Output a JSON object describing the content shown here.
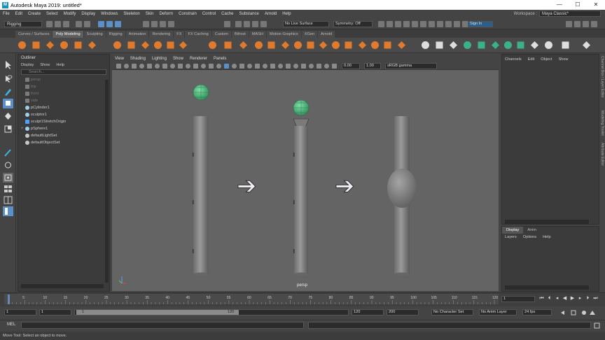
{
  "window": {
    "title": "Autodesk Maya 2019: untitled*",
    "app_icon": "maya-icon",
    "minimize": "—",
    "maximize": "☐",
    "close": "✕"
  },
  "menubar": [
    "File",
    "Edit",
    "Create",
    "Select",
    "Modify",
    "Display",
    "Windows",
    "Skeleton",
    "Skin",
    "Deform",
    "Constrain",
    "Control",
    "Cache",
    "Substance",
    "Arnold",
    "Help"
  ],
  "workspace": {
    "label": "Workspace :",
    "value": "Maya Classic*"
  },
  "statusline": {
    "mode": "Rigging",
    "live_surface": "No Live Surface",
    "symmetry": "Symmetry: Off",
    "sign_in": "Sign In"
  },
  "shelf_tabs": [
    "Curves / Surfaces",
    "Poly Modeling",
    "Sculpting",
    "Rigging",
    "Animation",
    "Rendering",
    "FX",
    "FX Caching",
    "Custom",
    "Bifrost",
    "MASH",
    "Motion Graphics",
    "XGen",
    "Arnold"
  ],
  "shelf_active": "Poly Modeling",
  "outliner": {
    "title": "Outliner",
    "menus": [
      "Display",
      "Show",
      "Help"
    ],
    "search_placeholder": "Search...",
    "items": [
      {
        "label": "persp",
        "dim": true,
        "icon": "camera-icon"
      },
      {
        "label": "top",
        "dim": true,
        "icon": "camera-icon"
      },
      {
        "label": "front",
        "dim": true,
        "icon": "camera-icon"
      },
      {
        "label": "side",
        "dim": true,
        "icon": "camera-icon"
      },
      {
        "label": "pCylinder1",
        "dim": false,
        "icon": "mesh-icon"
      },
      {
        "label": "sculptor1",
        "dim": false,
        "icon": "mesh-icon"
      },
      {
        "label": "sculpt1StretchOrigin",
        "dim": false,
        "icon": "locator-icon"
      },
      {
        "label": "pSphere1",
        "dim": false,
        "icon": "mesh-icon",
        "expand": "+"
      },
      {
        "label": "defaultLightSet",
        "dim": false,
        "icon": "set-icon"
      },
      {
        "label": "defaultObjectSet",
        "dim": false,
        "icon": "set-icon"
      }
    ]
  },
  "viewport": {
    "menus": [
      "View",
      "Shading",
      "Lighting",
      "Show",
      "Renderer",
      "Panels"
    ],
    "field_a": "0.00",
    "field_b": "1.00",
    "color_space": "sRGB gamma",
    "camera_label": "persp",
    "arrow_glyph": "➔"
  },
  "channelbox": {
    "menus": [
      "Channels",
      "Edit",
      "Object",
      "Show"
    ]
  },
  "layers": {
    "tabs": [
      "Display",
      "Anim"
    ],
    "menus": [
      "Layers",
      "Options",
      "Help"
    ]
  },
  "sidetabs": [
    "Channel Box / Layer Editor",
    "Modeling Toolkit",
    "Attribute Editor"
  ],
  "timeline": {
    "ticks": [
      "5",
      "10",
      "15",
      "20",
      "25",
      "30",
      "35",
      "40",
      "45",
      "50",
      "55",
      "60",
      "65",
      "70",
      "75",
      "80",
      "85",
      "90",
      "95",
      "100",
      "105",
      "110",
      "115",
      "120"
    ],
    "current_frame": "1"
  },
  "range": {
    "start": "1",
    "start2": "1",
    "slider_start": "1",
    "slider_end": "120",
    "end": "120",
    "end2": "200",
    "character_set": "No Character Set",
    "anim_layer": "No Anim Layer",
    "fps": "24 fps"
  },
  "mel": {
    "label": "MEL"
  },
  "helpline": "Move Tool: Select an object to move.",
  "colors": {
    "accent_orange": "#e07a2e",
    "accent_teal": "#3cb08a",
    "viewport_bg": "#646464",
    "cylinder": "#8a8a8a",
    "sphere_green": "#4cba7a"
  }
}
